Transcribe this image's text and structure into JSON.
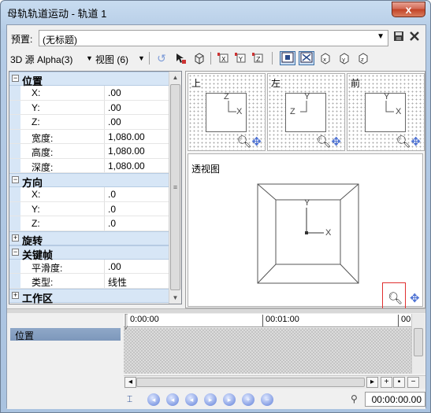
{
  "window": {
    "title": "母轨轨道运动 - 轨道 1",
    "close_glyph": "x"
  },
  "preset": {
    "label": "预置:",
    "value": "(无标题)"
  },
  "toolbar": {
    "mode_label": "3D 源 Alpha(3)",
    "view_label": "视图 (6)"
  },
  "properties": {
    "categories": [
      {
        "label": "位置",
        "expanded": true,
        "rows": [
          {
            "name": "X:",
            "value": ".00"
          },
          {
            "name": "Y:",
            "value": ".00"
          },
          {
            "name": "Z:",
            "value": ".00"
          },
          {
            "name": "宽度:",
            "value": "1,080.00"
          },
          {
            "name": "高度:",
            "value": "1,080.00"
          },
          {
            "name": "深度:",
            "value": "1,080.00"
          }
        ]
      },
      {
        "label": "方向",
        "expanded": true,
        "rows": [
          {
            "name": "X:",
            "value": ".0"
          },
          {
            "name": "Y:",
            "value": ".0"
          },
          {
            "name": "Z:",
            "value": ".0"
          }
        ]
      },
      {
        "label": "旋转",
        "expanded": false,
        "rows": []
      },
      {
        "label": "关键帧",
        "expanded": true,
        "rows": [
          {
            "name": "平滑度:",
            "value": ".00"
          },
          {
            "name": "类型:",
            "value": "线性"
          }
        ]
      },
      {
        "label": "工作区",
        "expanded": false,
        "rows": []
      }
    ]
  },
  "views": {
    "top": {
      "label": "上",
      "axis_a": "Z",
      "axis_b": "X"
    },
    "left": {
      "label": "左",
      "axis_a": "Y",
      "axis_b": "Z"
    },
    "front": {
      "label": "前",
      "axis_a": "Y",
      "axis_b": "X"
    },
    "perspective": {
      "label": "透视图",
      "axis_y": "Y",
      "axis_x": "X"
    }
  },
  "timeline": {
    "track_label": "位置",
    "ticks": [
      "0:00:00",
      "00:01:00",
      "00"
    ],
    "current_time": "00:00:00.00"
  }
}
